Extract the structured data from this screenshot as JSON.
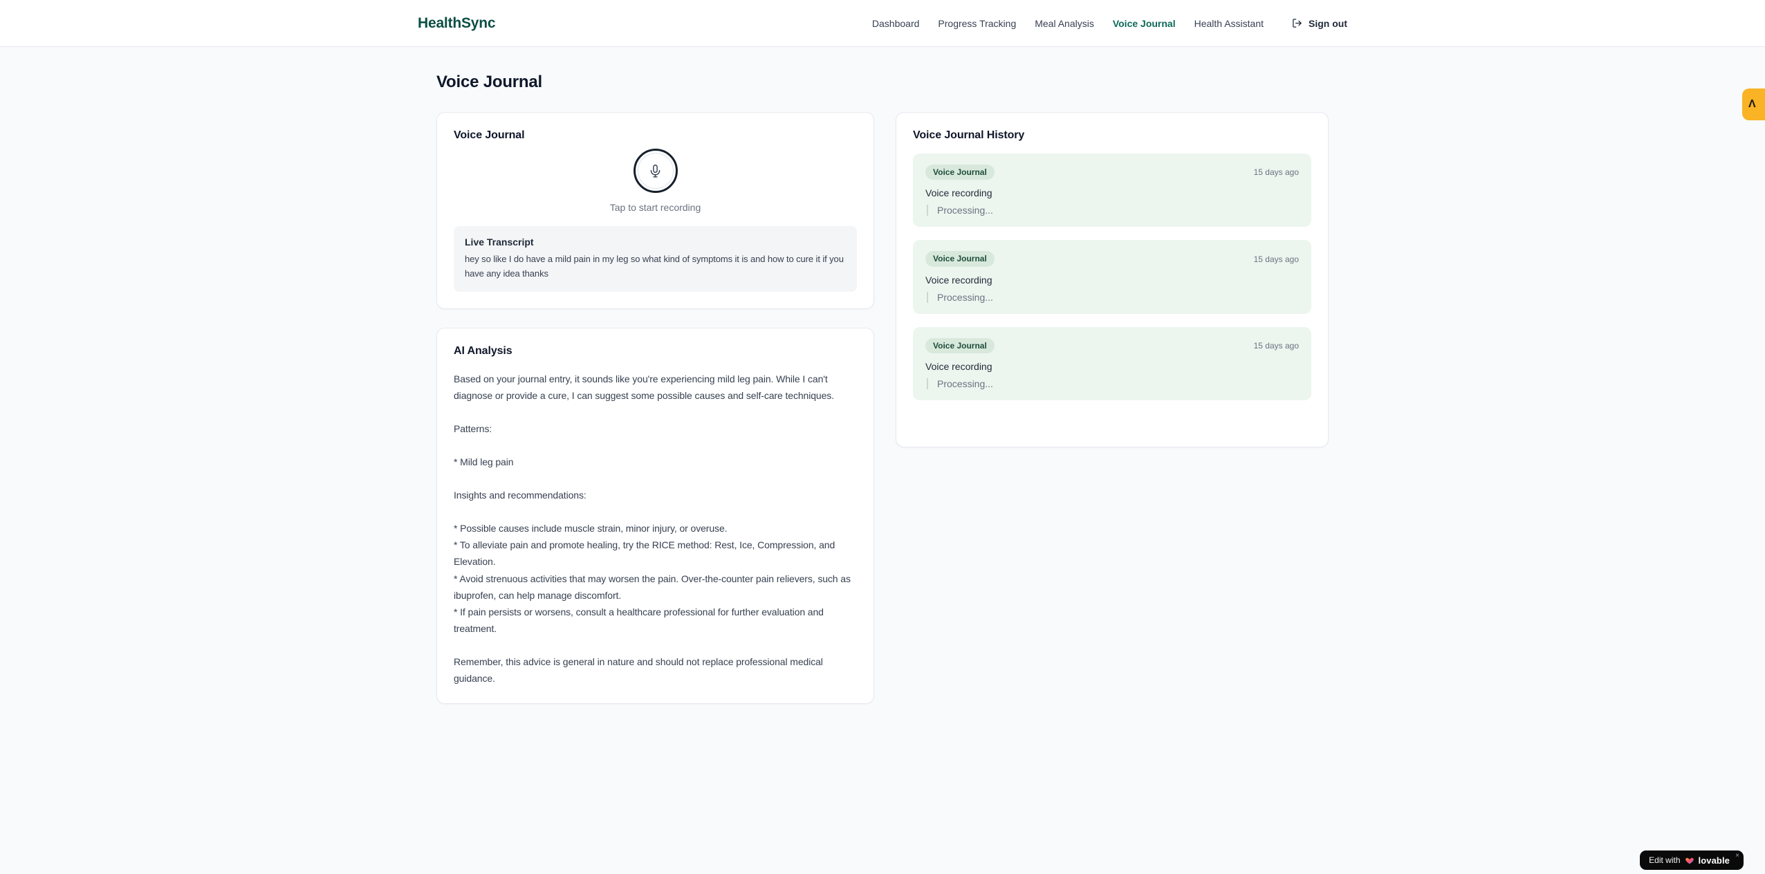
{
  "header": {
    "brand": "HealthSync",
    "nav": [
      {
        "label": "Dashboard",
        "active": false
      },
      {
        "label": "Progress Tracking",
        "active": false
      },
      {
        "label": "Meal Analysis",
        "active": false
      },
      {
        "label": "Voice Journal",
        "active": true
      },
      {
        "label": "Health Assistant",
        "active": false
      }
    ],
    "sign_out_label": "Sign out"
  },
  "page": {
    "title": "Voice Journal"
  },
  "recorder": {
    "title": "Voice Journal",
    "hint": "Tap to start recording",
    "transcript": {
      "title": "Live Transcript",
      "text": "hey so like I do have a mild pain in my leg so what kind of symptoms it is and how to cure it if you have any idea thanks"
    }
  },
  "analysis": {
    "title": "AI Analysis",
    "body": "Based on your journal entry, it sounds like you're experiencing mild leg pain. While I can't diagnose or provide a cure, I can suggest some possible causes and self-care techniques.\n\nPatterns:\n\n* Mild leg pain\n\nInsights and recommendations:\n\n* Possible causes include muscle strain, minor injury, or overuse.\n* To alleviate pain and promote healing, try the RICE method: Rest, Ice, Compression, and Elevation.\n* Avoid strenuous activities that may worsen the pain. Over-the-counter pain relievers, such as ibuprofen, can help manage discomfort.\n* If pain persists or worsens, consult a healthcare professional for further evaluation and treatment.\n\nRemember, this advice is general in nature and should not replace professional medical guidance."
  },
  "history": {
    "title": "Voice Journal History",
    "items": [
      {
        "badge": "Voice Journal",
        "time": "15 days ago",
        "title": "Voice recording",
        "status": "Processing..."
      },
      {
        "badge": "Voice Journal",
        "time": "15 days ago",
        "title": "Voice recording",
        "status": "Processing..."
      },
      {
        "badge": "Voice Journal",
        "time": "15 days ago",
        "title": "Voice recording",
        "status": "Processing..."
      }
    ]
  },
  "edge_button": {
    "glyph": "Λ"
  },
  "lovable": {
    "prefix": "Edit with",
    "brand": "lovable",
    "close": "×"
  },
  "colors": {
    "brand_teal": "#0c4f45",
    "nav_active_teal": "#0d6a58",
    "history_item_green": "#edf5ef",
    "badge_green_bg": "#d8e9dc",
    "badge_green_text": "#1e4d3b",
    "widget_amber": "#f9b324",
    "page_background": "#f8fafc"
  }
}
